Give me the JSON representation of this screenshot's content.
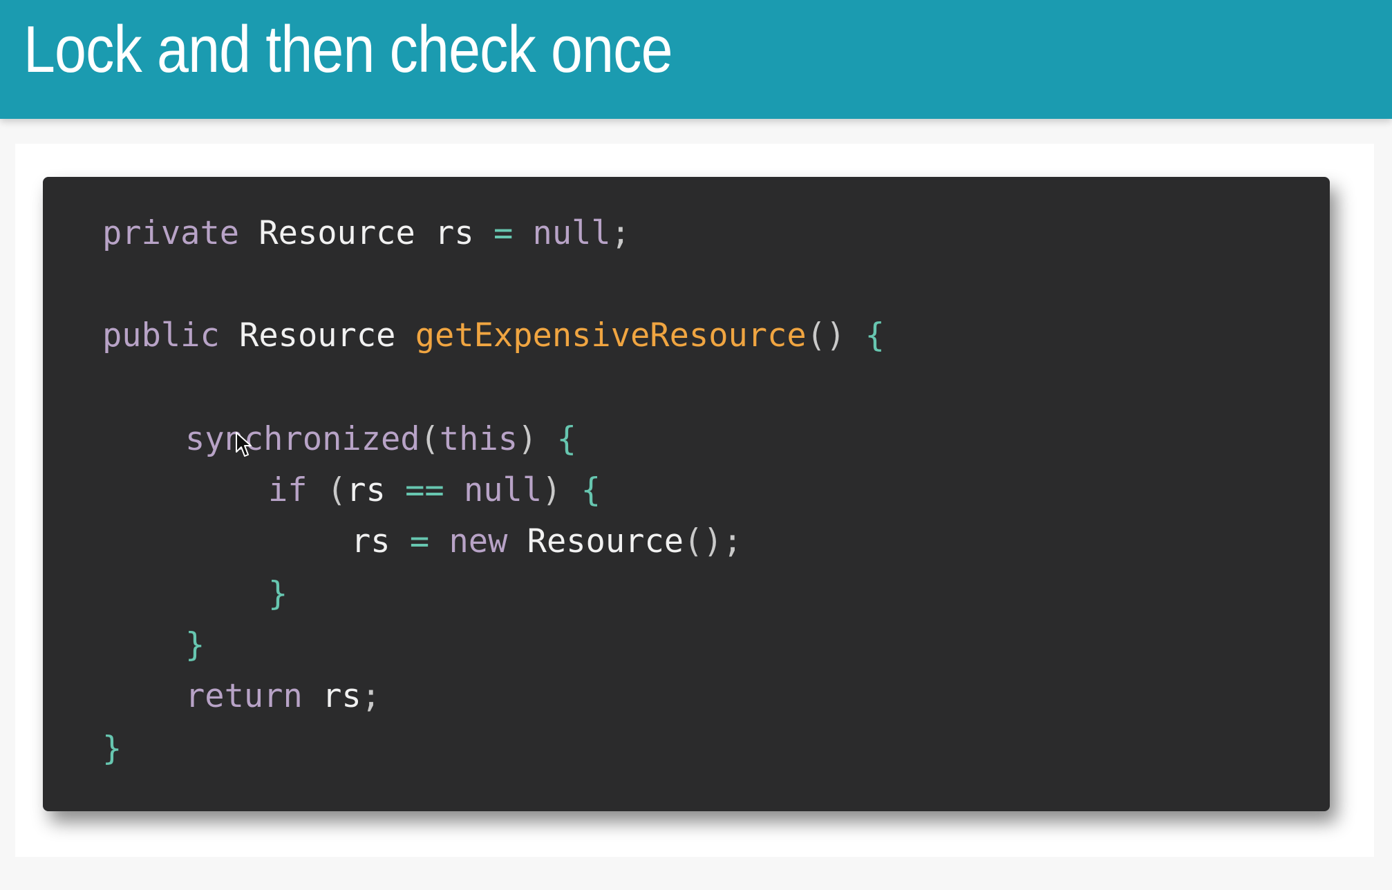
{
  "slide": {
    "title": "Lock and then check once"
  },
  "code": {
    "line1": {
      "kw": "private",
      "type": "Resource",
      "var": "rs",
      "op": "=",
      "val": "null",
      "end": ";"
    },
    "line2": {
      "kw": "public",
      "type": "Resource",
      "fn": "getExpensiveResource",
      "parens": "()",
      "brace": "{"
    },
    "line3": {
      "kw": "synchronized",
      "open": "(",
      "arg": "this",
      "close": ")",
      "brace": "{"
    },
    "line4": {
      "kw": "if",
      "open": "(",
      "var": "rs",
      "op": "==",
      "val": "null",
      "close": ")",
      "brace": "{"
    },
    "line5": {
      "var": "rs",
      "op": "=",
      "kw": "new",
      "type": "Resource",
      "parens": "()",
      "end": ";"
    },
    "line6": {
      "brace": "}"
    },
    "line7": {
      "brace": "}"
    },
    "line8": {
      "kw": "return",
      "var": "rs",
      "end": ";"
    },
    "line9": {
      "brace": "}"
    }
  },
  "colors": {
    "header": "#1b9bb0",
    "code_background": "#2b2b2c",
    "keyword": "#b8a3c7",
    "function": "#f0a541",
    "operator": "#67c6b0"
  },
  "icons": {
    "cursor": "mouse-pointer-icon"
  }
}
